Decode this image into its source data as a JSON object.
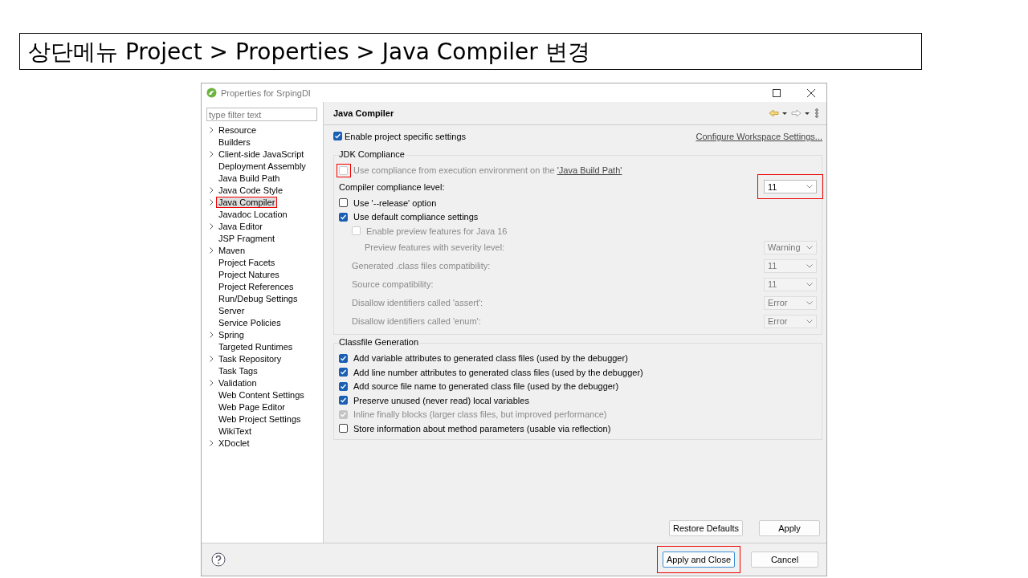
{
  "slide_title": "상단메뉴 Project > Properties > Java Compiler 변경",
  "window": {
    "title": "Properties for SrpingDI"
  },
  "filter": {
    "placeholder": "type filter text"
  },
  "tree": [
    {
      "label": "Resource",
      "expandable": true,
      "selected": false,
      "highlighted": false
    },
    {
      "label": "Builders",
      "expandable": false,
      "selected": false,
      "highlighted": false
    },
    {
      "label": "Client-side JavaScript",
      "expandable": true,
      "selected": false,
      "highlighted": false
    },
    {
      "label": "Deployment Assembly",
      "expandable": false,
      "selected": false,
      "highlighted": false
    },
    {
      "label": "Java Build Path",
      "expandable": false,
      "selected": false,
      "highlighted": false
    },
    {
      "label": "Java Code Style",
      "expandable": true,
      "selected": false,
      "highlighted": false
    },
    {
      "label": "Java Compiler",
      "expandable": true,
      "selected": true,
      "highlighted": true
    },
    {
      "label": "Javadoc Location",
      "expandable": false,
      "selected": false,
      "highlighted": false
    },
    {
      "label": "Java Editor",
      "expandable": true,
      "selected": false,
      "highlighted": false
    },
    {
      "label": "JSP Fragment",
      "expandable": false,
      "selected": false,
      "highlighted": false
    },
    {
      "label": "Maven",
      "expandable": true,
      "selected": false,
      "highlighted": false
    },
    {
      "label": "Project Facets",
      "expandable": false,
      "selected": false,
      "highlighted": false
    },
    {
      "label": "Project Natures",
      "expandable": false,
      "selected": false,
      "highlighted": false
    },
    {
      "label": "Project References",
      "expandable": false,
      "selected": false,
      "highlighted": false
    },
    {
      "label": "Run/Debug Settings",
      "expandable": false,
      "selected": false,
      "highlighted": false
    },
    {
      "label": "Server",
      "expandable": false,
      "selected": false,
      "highlighted": false
    },
    {
      "label": "Service Policies",
      "expandable": false,
      "selected": false,
      "highlighted": false
    },
    {
      "label": "Spring",
      "expandable": true,
      "selected": false,
      "highlighted": false
    },
    {
      "label": "Targeted Runtimes",
      "expandable": false,
      "selected": false,
      "highlighted": false
    },
    {
      "label": "Task Repository",
      "expandable": true,
      "selected": false,
      "highlighted": false
    },
    {
      "label": "Task Tags",
      "expandable": false,
      "selected": false,
      "highlighted": false
    },
    {
      "label": "Validation",
      "expandable": true,
      "selected": false,
      "highlighted": false
    },
    {
      "label": "Web Content Settings",
      "expandable": false,
      "selected": false,
      "highlighted": false
    },
    {
      "label": "Web Page Editor",
      "expandable": false,
      "selected": false,
      "highlighted": false
    },
    {
      "label": "Web Project Settings",
      "expandable": false,
      "selected": false,
      "highlighted": false
    },
    {
      "label": "WikiText",
      "expandable": false,
      "selected": false,
      "highlighted": false
    },
    {
      "label": "XDoclet",
      "expandable": true,
      "selected": false,
      "highlighted": false
    }
  ],
  "page": {
    "title": "Java Compiler",
    "enable": {
      "label": "Enable project specific settings",
      "checked": true
    },
    "configure_link": "Configure Workspace Settings...",
    "groups": [
      {
        "title": "JDK Compliance",
        "items": [
          {
            "kind": "checkbox",
            "label": "Use compliance from execution environment on the ",
            "link": "'Java Build Path'",
            "checked": false,
            "disabled": true,
            "highlighted": true
          },
          {
            "kind": "select",
            "label": "Compiler compliance level:",
            "value": "11",
            "disabled": false,
            "highlighted": true
          },
          {
            "kind": "checkbox",
            "label": "Use '--release' option",
            "checked": false,
            "disabled": false,
            "highlighted": false
          },
          {
            "kind": "checkbox",
            "label": "Use default compliance settings",
            "checked": true,
            "disabled": false,
            "highlighted": false,
            "children": [
              {
                "kind": "checkbox",
                "label": "Enable preview features for Java 16",
                "checked": false,
                "disabled": true,
                "highlighted": false,
                "children": [
                  {
                    "kind": "select",
                    "label": "Preview features with severity level:",
                    "value": "Warning",
                    "disabled": true,
                    "highlighted": false
                  }
                ]
              },
              {
                "kind": "select",
                "label": "Generated .class files compatibility:",
                "value": "11",
                "disabled": true,
                "highlighted": false
              },
              {
                "kind": "select",
                "label": "Source compatibility:",
                "value": "11",
                "disabled": true,
                "highlighted": false
              },
              {
                "kind": "select",
                "label": "Disallow identifiers called 'assert':",
                "value": "Error",
                "disabled": true,
                "highlighted": false
              },
              {
                "kind": "select",
                "label": "Disallow identifiers called 'enum':",
                "value": "Error",
                "disabled": true,
                "highlighted": false
              }
            ]
          }
        ]
      },
      {
        "title": "Classfile Generation",
        "items": [
          {
            "kind": "checkbox",
            "label": "Add variable attributes to generated class files (used by the debugger)",
            "checked": true,
            "disabled": false,
            "highlighted": false
          },
          {
            "kind": "checkbox",
            "label": "Add line number attributes to generated class files (used by the debugger)",
            "checked": true,
            "disabled": false,
            "highlighted": false
          },
          {
            "kind": "checkbox",
            "label": "Add source file name to generated class file (used by the debugger)",
            "checked": true,
            "disabled": false,
            "highlighted": false
          },
          {
            "kind": "checkbox",
            "label": "Preserve unused (never read) local variables",
            "checked": true,
            "disabled": false,
            "highlighted": false
          },
          {
            "kind": "checkbox",
            "label": "Inline finally blocks (larger class files, but improved performance)",
            "checked": true,
            "disabled": true,
            "highlighted": false
          },
          {
            "kind": "checkbox",
            "label": "Store information about method parameters (usable via reflection)",
            "checked": false,
            "disabled": false,
            "highlighted": false
          }
        ]
      }
    ],
    "buttons": [
      {
        "label": "Restore Defaults",
        "highlighted": false
      },
      {
        "label": "Apply",
        "highlighted": false
      }
    ]
  },
  "footer_buttons": [
    {
      "label": "Apply and Close",
      "default": true,
      "highlighted": true
    },
    {
      "label": "Cancel",
      "default": false,
      "highlighted": false
    }
  ]
}
